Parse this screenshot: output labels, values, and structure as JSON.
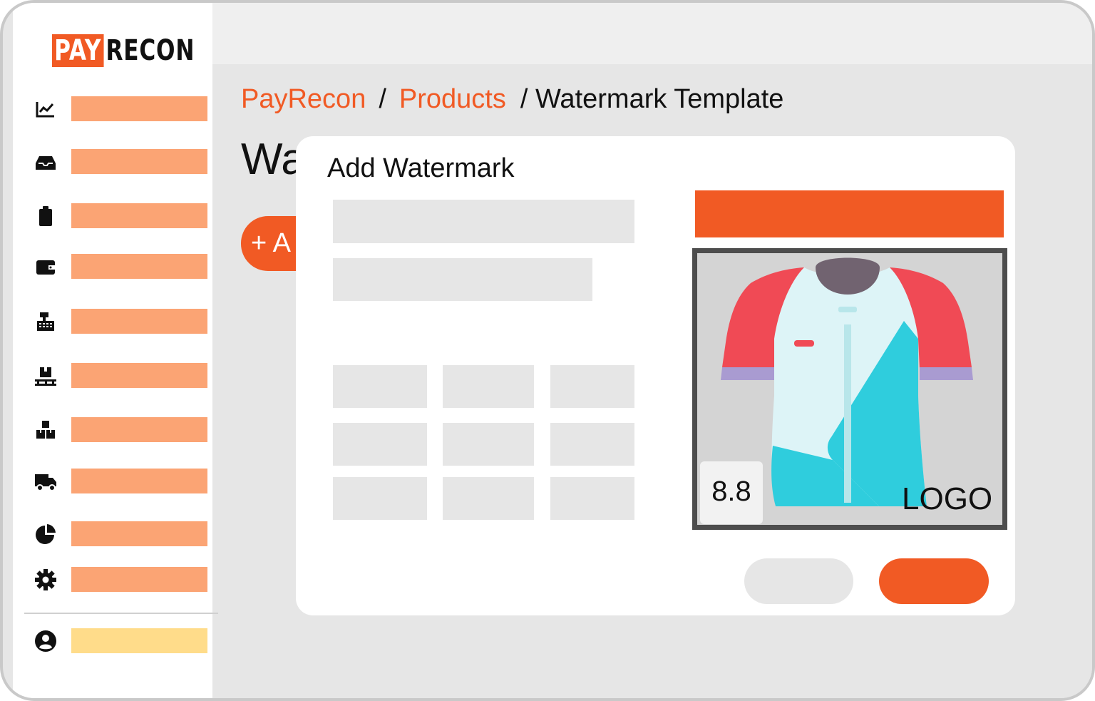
{
  "app": {
    "logo_part1": "PAY",
    "logo_part2": "RECON"
  },
  "colors": {
    "accent": "#f15a24",
    "nav_placeholder": "#fba474",
    "user_placeholder": "#ffdc8a",
    "placeholder_gray": "#e6e6e6"
  },
  "sidebar": {
    "items": [
      {
        "icon": "chart-line-icon"
      },
      {
        "icon": "inbox-icon"
      },
      {
        "icon": "clipboard-icon"
      },
      {
        "icon": "wallet-icon"
      },
      {
        "icon": "cash-register-icon"
      },
      {
        "icon": "pallet-box-icon"
      },
      {
        "icon": "boxes-stacked-icon"
      },
      {
        "icon": "truck-icon"
      },
      {
        "icon": "pie-chart-icon"
      },
      {
        "icon": "gear-icon"
      }
    ],
    "user": {
      "icon": "user-circle-icon"
    }
  },
  "breadcrumb": {
    "root": "PayRecon",
    "sep": "/",
    "section": "Products",
    "current": "/ Watermark Template"
  },
  "page": {
    "title": "Wa",
    "add_button": "+ A"
  },
  "modal": {
    "title": "Add Watermark",
    "preview": {
      "image": "t-shirt-icon",
      "badge": "8.8",
      "watermark": "LOGO"
    }
  }
}
